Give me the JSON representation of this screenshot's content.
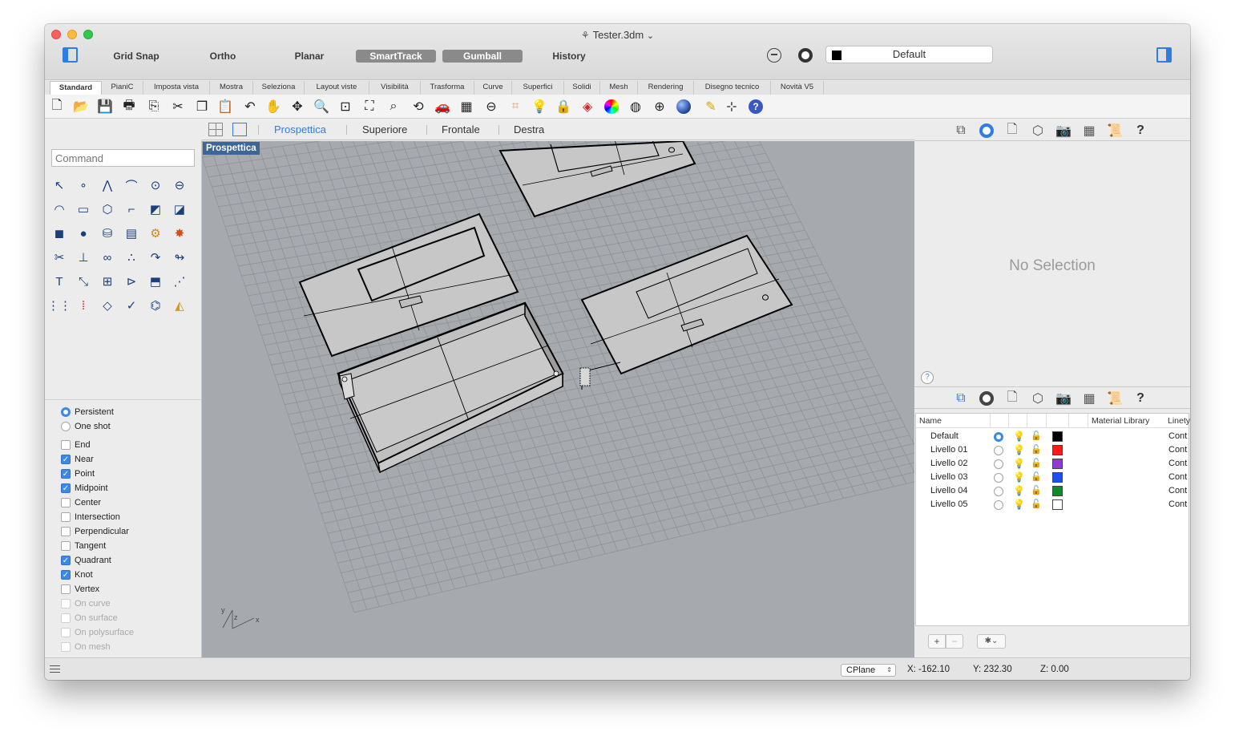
{
  "window": {
    "title": "Tester.3dm",
    "title_chevron": "⌄",
    "doc_icon": "rhino-doc-icon"
  },
  "topbar": {
    "buttons": [
      {
        "label": "Grid Snap",
        "active": false
      },
      {
        "label": "Ortho",
        "active": false
      },
      {
        "label": "Planar",
        "active": false
      },
      {
        "label": "SmartTrack",
        "active": true
      },
      {
        "label": "Gumball",
        "active": true
      },
      {
        "label": "History",
        "active": false
      }
    ],
    "current_layer": "Default"
  },
  "tabs": [
    "Standard",
    "PianiC",
    "Imposta vista",
    "Mostra",
    "Seleziona",
    "Layout viste",
    "Visibilità",
    "Trasforma",
    "Curve",
    "Superfici",
    "Solidi",
    "Mesh",
    "Rendering",
    "Disegno tecnico",
    "Novità V5"
  ],
  "toolbar_icons": [
    "new-file-icon",
    "open-folder-icon",
    "save-icon",
    "print-icon",
    "export-icon",
    "cut-icon",
    "copy-icon",
    "paste-icon",
    "undo-icon",
    "pan-hand-icon",
    "move-view-icon",
    "zoom-icon",
    "zoom-window-icon",
    "zoom-extents-icon",
    "zoom-selected-icon",
    "rotate-view-icon",
    "car-icon",
    "grid-view-icon",
    "properties-icon",
    "select-filter-icon",
    "bulb-icon",
    "lock-icon",
    "layer-icon",
    "color-wheel-icon",
    "wire-sphere-icon",
    "mesh-sphere-icon",
    "render-sphere-icon",
    "pen-icon",
    "dimension-icon",
    "help-icon"
  ],
  "viewtabs": {
    "tabs": [
      "Prospettica",
      "Superiore",
      "Frontale",
      "Destra"
    ],
    "active": "Prospettica"
  },
  "left_panel": {
    "command_placeholder": "Command",
    "mode_options": [
      {
        "label": "Persistent",
        "checked": true
      },
      {
        "label": "One shot",
        "checked": false
      }
    ],
    "snaps": [
      {
        "label": "End",
        "checked": false,
        "enabled": true
      },
      {
        "label": "Near",
        "checked": true,
        "enabled": true
      },
      {
        "label": "Point",
        "checked": true,
        "enabled": true
      },
      {
        "label": "Midpoint",
        "checked": true,
        "enabled": true
      },
      {
        "label": "Center",
        "checked": false,
        "enabled": true
      },
      {
        "label": "Intersection",
        "checked": false,
        "enabled": true
      },
      {
        "label": "Perpendicular",
        "checked": false,
        "enabled": true
      },
      {
        "label": "Tangent",
        "checked": false,
        "enabled": true
      },
      {
        "label": "Quadrant",
        "checked": true,
        "enabled": true
      },
      {
        "label": "Knot",
        "checked": true,
        "enabled": true
      },
      {
        "label": "Vertex",
        "checked": false,
        "enabled": true
      },
      {
        "label": "On curve",
        "checked": false,
        "enabled": false
      },
      {
        "label": "On surface",
        "checked": false,
        "enabled": false
      },
      {
        "label": "On polysurface",
        "checked": false,
        "enabled": false
      },
      {
        "label": "On mesh",
        "checked": false,
        "enabled": false
      }
    ]
  },
  "viewport": {
    "label": "Prospettica",
    "axis_labels": {
      "y": "y",
      "z": "z",
      "x": "x"
    }
  },
  "properties": {
    "empty_text": "No Selection",
    "help": "?"
  },
  "layers": {
    "columns": [
      "Name",
      "Material Library",
      "Linetype"
    ],
    "rows": [
      {
        "name": "Default",
        "current": true,
        "color": "#000000",
        "linetype": "Cont"
      },
      {
        "name": "Livello 01",
        "current": false,
        "color": "#ff1a1a",
        "linetype": "Cont"
      },
      {
        "name": "Livello 02",
        "current": false,
        "color": "#8e3bd6",
        "linetype": "Cont"
      },
      {
        "name": "Livello 03",
        "current": false,
        "color": "#1f4ef0",
        "linetype": "Cont"
      },
      {
        "name": "Livello 04",
        "current": false,
        "color": "#0f8a2b",
        "linetype": "Cont"
      },
      {
        "name": "Livello 05",
        "current": false,
        "color": "#ffffff",
        "linetype": "Cont"
      }
    ],
    "add_label": "+",
    "remove_label": "−",
    "gear_label": "✱⌄"
  },
  "statusbar": {
    "cplane": "CPlane",
    "x": "X: -162.10",
    "y": "Y: 232.30",
    "z": "Z: 0.00"
  },
  "colors": {
    "accent": "#2f7de1",
    "viewport_bg": "#a6a9ae",
    "viewport_label_bg": "#3d6596"
  }
}
